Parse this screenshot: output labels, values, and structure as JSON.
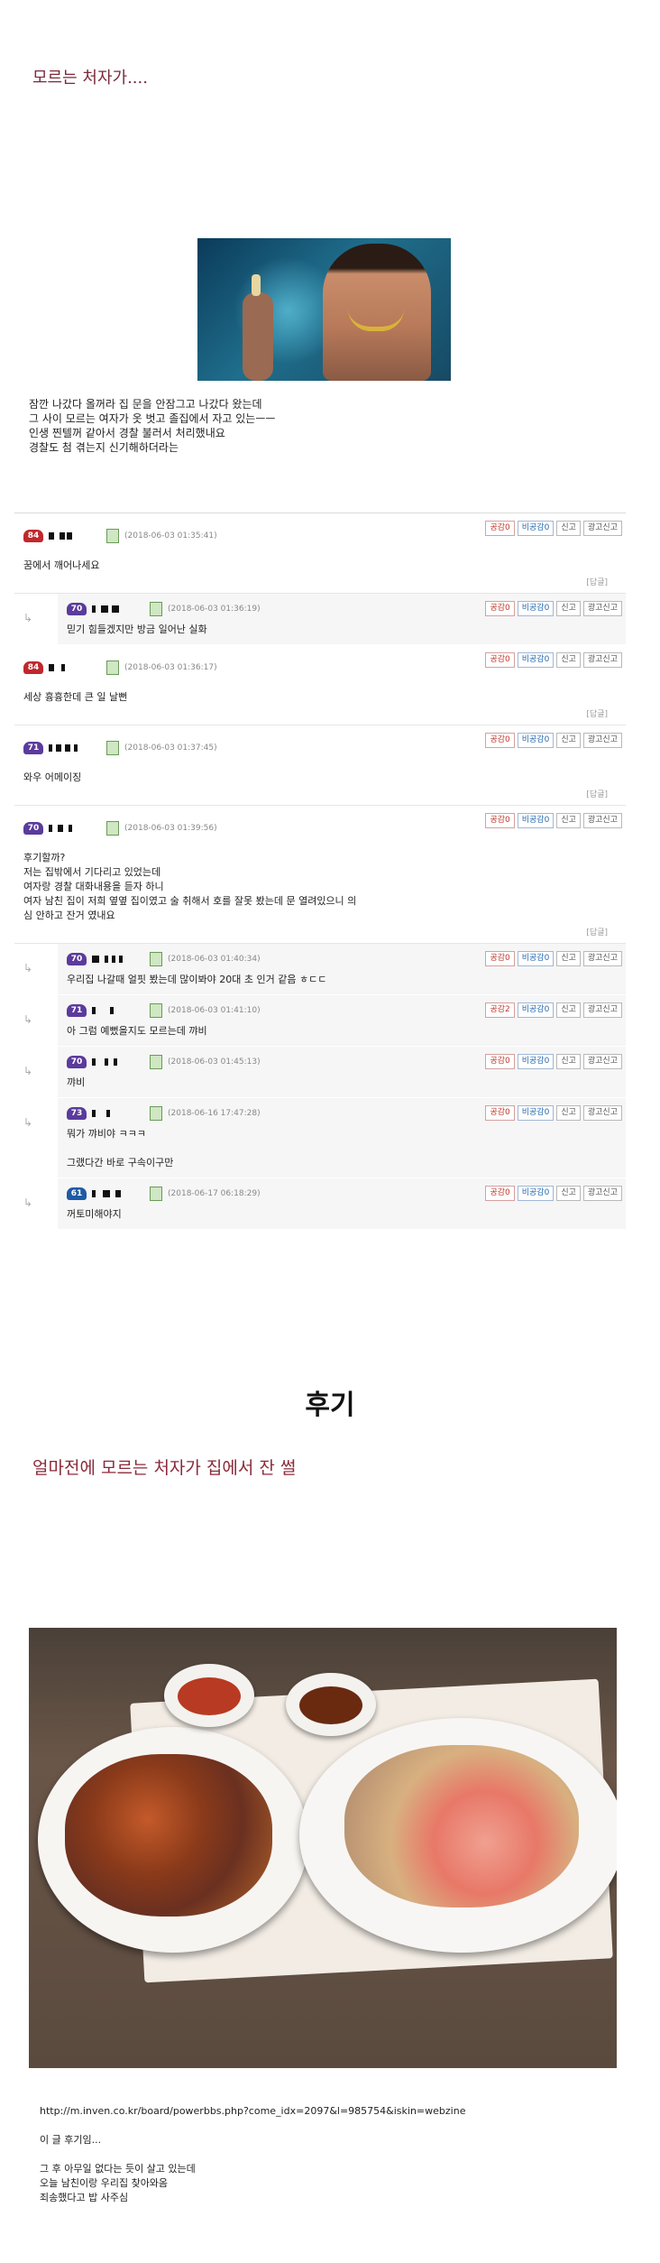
{
  "post": {
    "title": "모르는 처자가....",
    "text_lines": [
      "잠깐 나갔다 올꺼라 집 문을 안잠그고 나갔다 왔는데",
      "그 사이 모르는 여자가 옷 벗고 졸집에서 자고 있는ㅡㅡ",
      "인생 찐텔꺼 같아서 경찰 불러서 처리했내요",
      "경찰도 첨 겪는지 신기해하더라는"
    ]
  },
  "comment_labels": {
    "up_prefix": "공감",
    "down_prefix": "비공감",
    "report": "신고",
    "ad_report": "광고신고",
    "reply": "[답글]",
    "reply_arrow": "↳"
  },
  "comments": [
    {
      "level": "84",
      "level_color": "red",
      "date": "(2018-06-03 01:35:41)",
      "up": "0",
      "down": "0",
      "lines": [
        "꿈에서 깨어나세요"
      ],
      "reply": false,
      "has_reply_link": true
    },
    {
      "level": "70",
      "level_color": "purple",
      "date": "(2018-06-03 01:36:19)",
      "up": "0",
      "down": "0",
      "lines": [
        "믿기 힘들겠지만 방금 일어난 실화"
      ],
      "reply": true,
      "has_reply_link": false
    },
    {
      "level": "84",
      "level_color": "red",
      "date": "(2018-06-03 01:36:17)",
      "up": "0",
      "down": "0",
      "lines": [
        "세상 흉흉한데 큰 일 날뻔"
      ],
      "reply": false,
      "has_reply_link": true
    },
    {
      "level": "71",
      "level_color": "purple",
      "date": "(2018-06-03 01:37:45)",
      "up": "0",
      "down": "0",
      "lines": [
        "와우 어메이징"
      ],
      "reply": false,
      "has_reply_link": true
    },
    {
      "level": "70",
      "level_color": "purple",
      "date": "(2018-06-03 01:39:56)",
      "up": "0",
      "down": "0",
      "lines": [
        "후기할까?",
        "저는 집밖에서 기다리고 있었는데",
        "여자랑 경찰 대화내용을 듣자 하니",
        "여자 남친 집이 저희 옆옆 집이였고 술 취해서 호를 잘못 봤는데 문 열려있으니 의",
        "심 안하고 잔거 였내요"
      ],
      "reply": false,
      "has_reply_link": true
    },
    {
      "level": "70",
      "level_color": "purple",
      "date": "(2018-06-03 01:40:34)",
      "up": "0",
      "down": "0",
      "lines": [
        "우리집 나갈때 얼핏 봤는데 많이봐야 20대 초 인거 같음 ㅎㄷㄷ"
      ],
      "reply": true,
      "has_reply_link": false
    },
    {
      "level": "71",
      "level_color": "purple",
      "date": "(2018-06-03 01:41:10)",
      "up": "2",
      "down": "0",
      "lines": [
        "아 그럼 예뻤을지도 모르는데 꺄비"
      ],
      "reply": true,
      "has_reply_link": false
    },
    {
      "level": "70",
      "level_color": "purple",
      "date": "(2018-06-03 01:45:13)",
      "up": "0",
      "down": "0",
      "lines": [
        "꺄비"
      ],
      "reply": true,
      "has_reply_link": false
    },
    {
      "level": "73",
      "level_color": "purple",
      "date": "(2018-06-16 17:47:28)",
      "up": "0",
      "down": "0",
      "lines": [
        "뭐가 꺄비야 ㅋㅋㅋ",
        "",
        "그랬다간 바로 구속이구만"
      ],
      "reply": true,
      "has_reply_link": false
    },
    {
      "level": "61",
      "level_color": "blue",
      "date": "(2018-06-17 06:18:29)",
      "up": "0",
      "down": "0",
      "lines": [
        "꺼토미해야지"
      ],
      "reply": true,
      "has_reply_link": false
    }
  ],
  "section2": {
    "heading": "후기",
    "title": "얼마전에 모르는 처자가 집에서 잔 썰"
  },
  "footer": {
    "lines": [
      "http://m.inven.co.kr/board/powerbbs.php?come_idx=2097&l=985754&iskin=webzine",
      "",
      "이 글 후기임...",
      "",
      "그 후 아무일 없다는 듯이 살고 있는데",
      "오늘 남친이랑 우리집 찾아와옴",
      "죄송했다고 밥 사주심"
    ]
  }
}
